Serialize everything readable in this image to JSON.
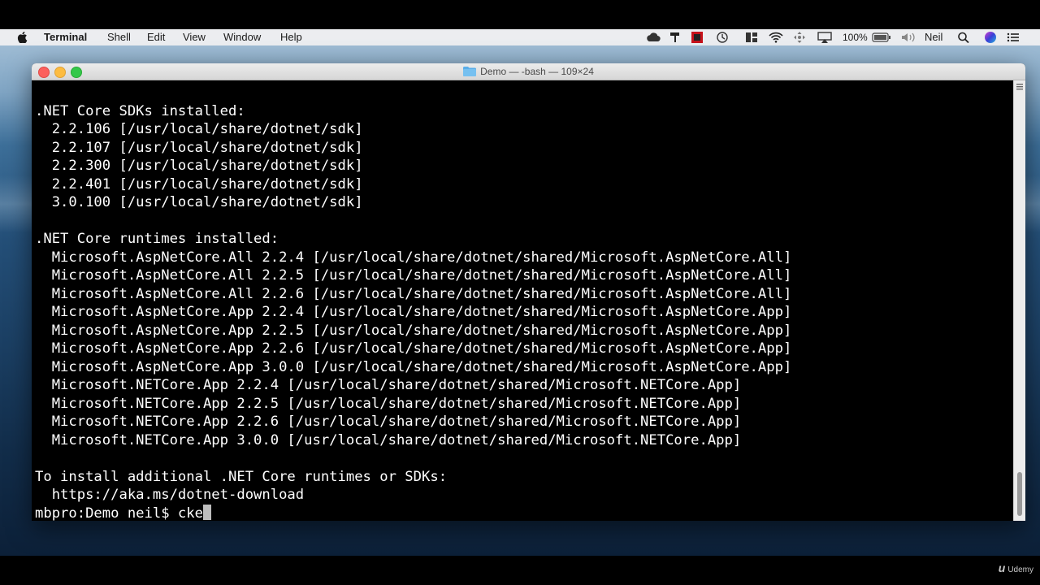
{
  "menubar": {
    "app_name": "Terminal",
    "items": [
      "Shell",
      "Edit",
      "View",
      "Window",
      "Help"
    ],
    "battery": "100%",
    "user": "Neil",
    "status_icons": [
      "cloud-icon",
      "paint-icon",
      "record-icon",
      "time-machine-icon",
      "window-layout-icon",
      "wifi-icon",
      "move-icon",
      "airplay-icon",
      "battery-icon",
      "volume-icon",
      "search-icon",
      "siri-icon",
      "notification-icon"
    ]
  },
  "window": {
    "title": "Demo — -bash — 109×24"
  },
  "terminal": {
    "lines": [
      "",
      ".NET Core SDKs installed:",
      "  2.2.106 [/usr/local/share/dotnet/sdk]",
      "  2.2.107 [/usr/local/share/dotnet/sdk]",
      "  2.2.300 [/usr/local/share/dotnet/sdk]",
      "  2.2.401 [/usr/local/share/dotnet/sdk]",
      "  3.0.100 [/usr/local/share/dotnet/sdk]",
      "",
      ".NET Core runtimes installed:",
      "  Microsoft.AspNetCore.All 2.2.4 [/usr/local/share/dotnet/shared/Microsoft.AspNetCore.All]",
      "  Microsoft.AspNetCore.All 2.2.5 [/usr/local/share/dotnet/shared/Microsoft.AspNetCore.All]",
      "  Microsoft.AspNetCore.All 2.2.6 [/usr/local/share/dotnet/shared/Microsoft.AspNetCore.All]",
      "  Microsoft.AspNetCore.App 2.2.4 [/usr/local/share/dotnet/shared/Microsoft.AspNetCore.App]",
      "  Microsoft.AspNetCore.App 2.2.5 [/usr/local/share/dotnet/shared/Microsoft.AspNetCore.App]",
      "  Microsoft.AspNetCore.App 2.2.6 [/usr/local/share/dotnet/shared/Microsoft.AspNetCore.App]",
      "  Microsoft.AspNetCore.App 3.0.0 [/usr/local/share/dotnet/shared/Microsoft.AspNetCore.App]",
      "  Microsoft.NETCore.App 2.2.4 [/usr/local/share/dotnet/shared/Microsoft.NETCore.App]",
      "  Microsoft.NETCore.App 2.2.5 [/usr/local/share/dotnet/shared/Microsoft.NETCore.App]",
      "  Microsoft.NETCore.App 2.2.6 [/usr/local/share/dotnet/shared/Microsoft.NETCore.App]",
      "  Microsoft.NETCore.App 3.0.0 [/usr/local/share/dotnet/shared/Microsoft.NETCore.App]",
      "",
      "To install additional .NET Core runtimes or SDKs:",
      "  https://aka.ms/dotnet-download"
    ],
    "prompt": "mbpro:Demo neil$ ",
    "input": "cke"
  },
  "watermark": {
    "brand": "Udemy",
    "logo": "u"
  },
  "colors": {
    "terminal_bg": "#000000",
    "terminal_fg": "#ffffff",
    "close": "#fc605c",
    "minimize": "#fdbc40",
    "maximize": "#34c84a",
    "folder": "#5aaee8"
  }
}
